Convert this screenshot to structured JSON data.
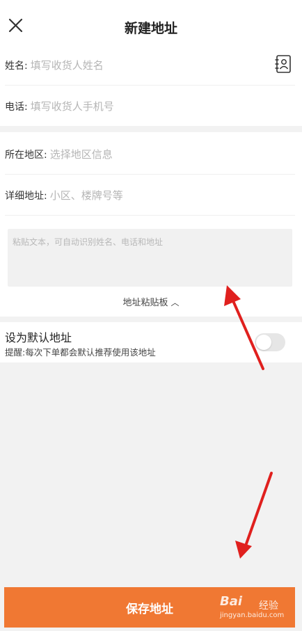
{
  "header": {
    "title": "新建地址",
    "close_icon": "close-icon"
  },
  "form": {
    "name": {
      "label": "姓名:",
      "placeholder": "填写收货人姓名"
    },
    "phone": {
      "label": "电话:",
      "placeholder": "填写收货人手机号"
    },
    "region": {
      "label": "所在地区:",
      "placeholder": "选择地区信息"
    },
    "detail": {
      "label": "详细地址:",
      "placeholder": "小区、楼牌号等"
    },
    "contacts_icon": "contacts-book-icon"
  },
  "paste": {
    "placeholder": "粘贴文本，可自动识别姓名、电话和地址",
    "toggle_label": "地址粘贴板",
    "toggle_icon": "chevron-up-icon"
  },
  "default_setting": {
    "title": "设为默认地址",
    "hint": "提醒:每次下单都会默认推荐使用该地址",
    "enabled": false
  },
  "footer": {
    "save_label": "保存地址"
  },
  "watermark": {
    "logo": "Bai",
    "brand": "经验",
    "url": "jingyan.baidu.com"
  },
  "colors": {
    "accent": "#f07833",
    "annotation_arrow": "#e0201e"
  }
}
